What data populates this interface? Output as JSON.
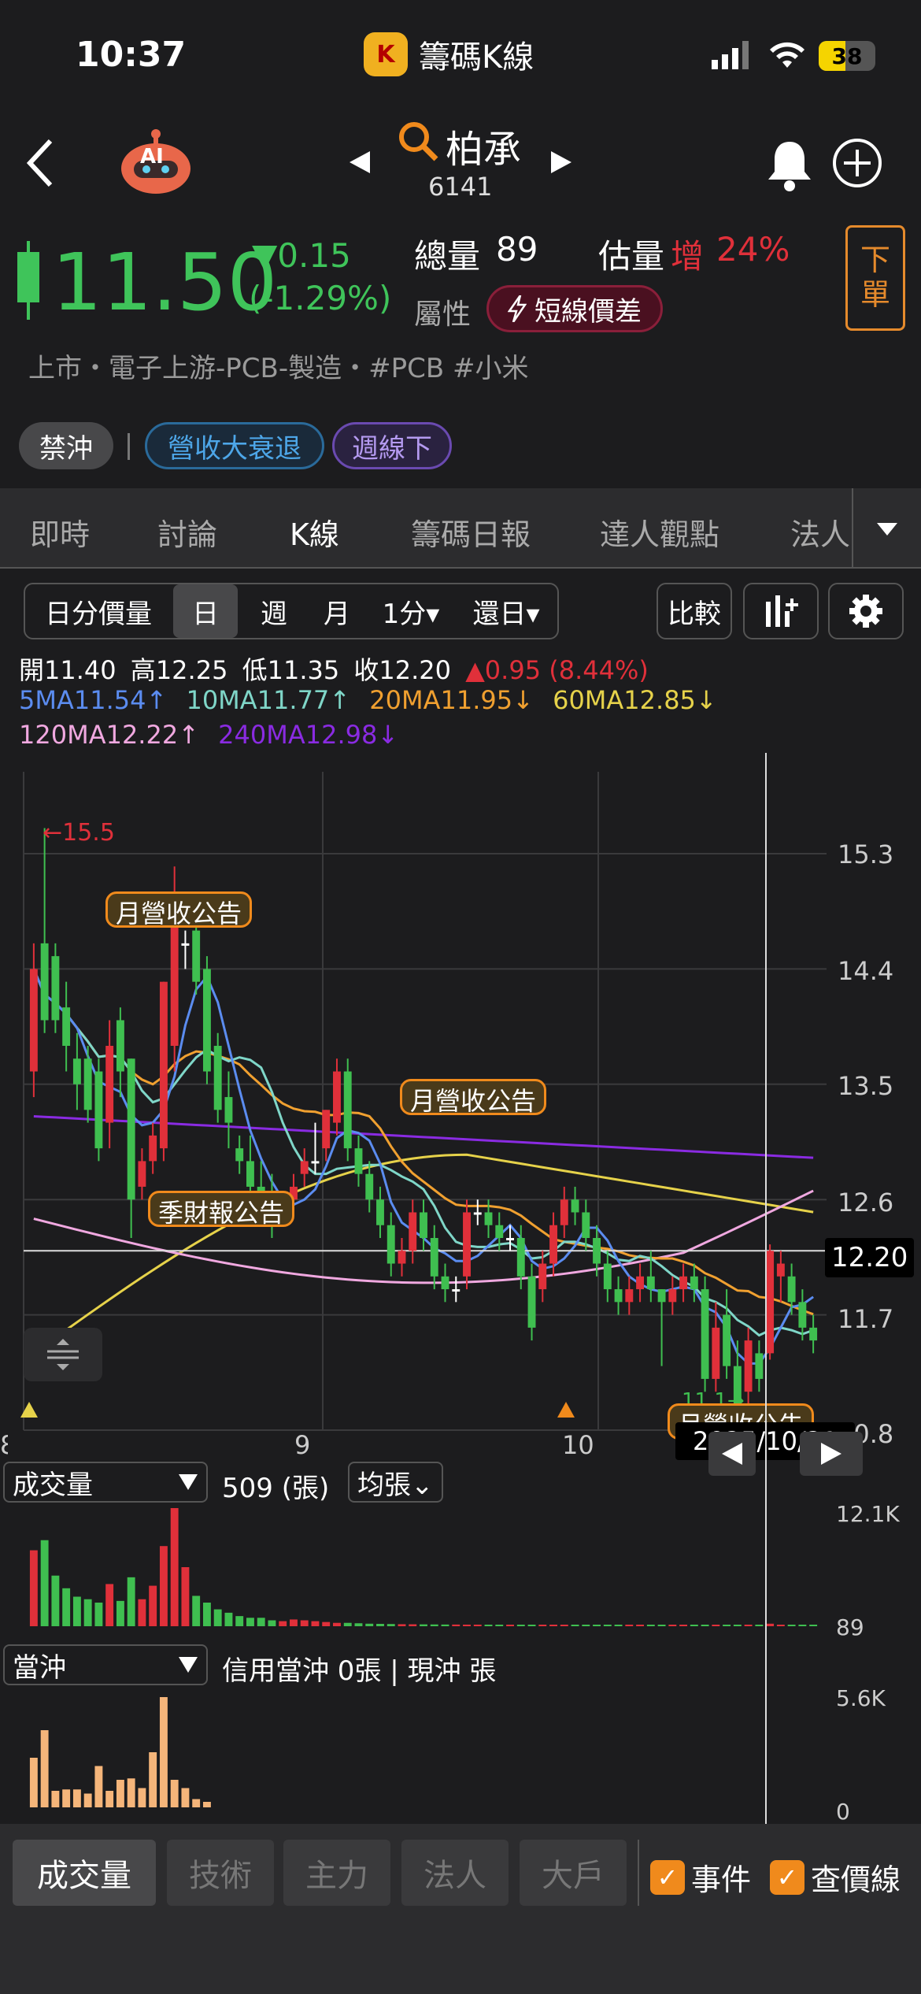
{
  "status": {
    "time": "10:37",
    "app_name": "籌碼K線",
    "app_logo_letter": "K",
    "battery": "38"
  },
  "header": {
    "stock_name": "柏承",
    "stock_code": "6141",
    "price": "11.50",
    "change": "▼0.15",
    "change_pct": "(-1.29%)",
    "volume_label": "總量",
    "volume_value": "89",
    "est_label": "估量",
    "est_dir": "增",
    "est_value": "24%",
    "attr_label": "屬性",
    "attr_badge": "短線價差",
    "order_button": [
      "下",
      "單"
    ],
    "industry": "上市・電子上游-PCB-製造・#PCB #小米",
    "tags": [
      "禁沖",
      "營收大衰退",
      "週線下"
    ],
    "ai_label": "AI"
  },
  "tabs": [
    "即時",
    "討論",
    "K線",
    "籌碼日報",
    "達人觀點",
    "法人"
  ],
  "toolbar": {
    "periods": [
      "日分價量",
      "日",
      "週",
      "月",
      "1分▾",
      "還日▾"
    ],
    "compare": "比較"
  },
  "ohlc": {
    "open_label": "開",
    "open": "11.40",
    "high_label": "高",
    "high": "12.25",
    "low_label": "低",
    "low": "11.35",
    "close_label": "收",
    "close": "12.20",
    "change": "▲0.95 (8.44%)"
  },
  "ma": {
    "ma5": "5MA11.54↑",
    "ma10": "10MA11.77↑",
    "ma20": "20MA11.95↓",
    "ma60": "60MA12.85↓",
    "ma120": "120MA12.22↑",
    "ma240": "240MA12.98↓"
  },
  "colors": {
    "up": "#e0303a",
    "down": "#3fbf50",
    "ma5": "#5b8cf0",
    "ma10": "#7fd6c8",
    "ma20": "#f0a030",
    "ma60": "#e6d24a",
    "ma120": "#f0a8e0",
    "ma240": "#8a2be2",
    "accent": "#f08a1c"
  },
  "chart_data": {
    "type": "candlestick",
    "y_ticks": [
      "15.3",
      "14.4",
      "13.5",
      "12.6",
      "11.7",
      "10.8"
    ],
    "x_ticks": [
      "8",
      "9",
      "10"
    ],
    "max_label": "←15.5",
    "min_label": "11.1→",
    "crosshair_value": "12.20",
    "crosshair_date": "2025/10/21",
    "candles": [
      [
        13.6,
        14.4,
        13.4,
        14.6
      ],
      [
        14.6,
        14.0,
        13.9,
        15.5
      ],
      [
        14.5,
        14.0,
        13.9,
        14.6
      ],
      [
        14.1,
        13.8,
        13.6,
        14.3
      ],
      [
        13.7,
        13.5,
        13.3,
        13.9
      ],
      [
        13.7,
        13.3,
        13.2,
        13.8
      ],
      [
        13.6,
        13.0,
        12.9,
        13.7
      ],
      [
        13.2,
        13.8,
        13.0,
        14.0
      ],
      [
        14.0,
        13.6,
        13.4,
        14.1
      ],
      [
        13.7,
        12.6,
        12.3,
        13.7
      ],
      [
        12.7,
        12.9,
        12.6,
        13.0
      ],
      [
        12.9,
        13.1,
        12.8,
        13.2
      ],
      [
        13.0,
        14.3,
        12.9,
        14.3
      ],
      [
        13.8,
        14.9,
        13.6,
        15.2
      ],
      [
        14.6,
        14.6,
        14.4,
        14.7
      ],
      [
        14.7,
        14.3,
        14.2,
        14.9
      ],
      [
        14.4,
        13.6,
        13.5,
        14.5
      ],
      [
        13.8,
        13.3,
        13.2,
        13.9
      ],
      [
        13.4,
        13.2,
        13.0,
        13.6
      ],
      [
        13.0,
        12.9,
        12.8,
        13.1
      ],
      [
        12.9,
        12.7,
        12.6,
        13.1
      ],
      [
        12.7,
        12.5,
        12.4,
        12.9
      ],
      [
        12.6,
        12.4,
        12.3,
        12.8
      ],
      [
        12.5,
        12.5,
        12.4,
        12.6
      ],
      [
        12.6,
        12.7,
        12.5,
        12.8
      ],
      [
        12.8,
        12.9,
        12.7,
        13.0
      ],
      [
        12.9,
        12.9,
        12.8,
        13.2
      ],
      [
        13.0,
        13.3,
        12.9,
        13.3
      ],
      [
        13.2,
        13.6,
        13.1,
        13.7
      ],
      [
        13.6,
        13.0,
        12.9,
        13.7
      ],
      [
        13.0,
        12.8,
        12.7,
        13.1
      ],
      [
        12.8,
        12.6,
        12.5,
        12.9
      ],
      [
        12.6,
        12.4,
        12.3,
        12.7
      ],
      [
        12.4,
        12.1,
        12.0,
        12.5
      ],
      [
        12.1,
        12.2,
        12.0,
        12.3
      ],
      [
        12.2,
        12.5,
        12.1,
        12.6
      ],
      [
        12.5,
        12.3,
        12.2,
        12.6
      ],
      [
        12.3,
        12.0,
        11.9,
        12.4
      ],
      [
        12.0,
        11.9,
        11.8,
        12.1
      ],
      [
        11.9,
        11.9,
        11.8,
        12.0
      ],
      [
        12.0,
        12.5,
        11.9,
        12.6
      ],
      [
        12.5,
        12.5,
        12.4,
        12.6
      ],
      [
        12.5,
        12.4,
        12.3,
        12.6
      ],
      [
        12.4,
        12.3,
        12.2,
        12.5
      ],
      [
        12.3,
        12.3,
        12.2,
        12.4
      ],
      [
        12.3,
        12.0,
        11.9,
        12.4
      ],
      [
        12.0,
        11.6,
        11.5,
        12.1
      ],
      [
        11.9,
        12.1,
        11.8,
        12.2
      ],
      [
        12.1,
        12.4,
        12.0,
        12.5
      ],
      [
        12.4,
        12.6,
        12.3,
        12.7
      ],
      [
        12.6,
        12.5,
        12.4,
        12.7
      ],
      [
        12.5,
        12.3,
        12.2,
        12.6
      ],
      [
        12.3,
        12.1,
        12.0,
        12.4
      ],
      [
        12.1,
        11.9,
        11.8,
        12.2
      ],
      [
        11.9,
        11.8,
        11.7,
        12.0
      ],
      [
        11.8,
        11.9,
        11.7,
        12.0
      ],
      [
        11.9,
        12.0,
        11.8,
        12.1
      ],
      [
        12.0,
        11.9,
        11.8,
        12.2
      ],
      [
        11.9,
        11.8,
        11.3,
        11.9
      ],
      [
        11.8,
        11.9,
        11.7,
        12.0
      ],
      [
        11.9,
        12.0,
        11.8,
        12.1
      ],
      [
        12.0,
        11.9,
        11.8,
        12.1
      ],
      [
        11.9,
        11.2,
        11.1,
        12.0
      ],
      [
        11.2,
        11.6,
        11.1,
        11.8
      ],
      [
        11.7,
        11.3,
        11.2,
        11.9
      ],
      [
        11.3,
        11.0,
        11.0,
        11.5
      ],
      [
        11.1,
        11.5,
        11.0,
        11.6
      ],
      [
        11.4,
        11.2,
        11.1,
        11.5
      ],
      [
        11.4,
        12.2,
        11.35,
        12.25
      ],
      [
        12.0,
        12.1,
        11.8,
        12.2
      ],
      [
        12.0,
        11.8,
        11.7,
        12.1
      ],
      [
        11.8,
        11.6,
        11.5,
        11.9
      ],
      [
        11.6,
        11.5,
        11.4,
        11.7
      ]
    ],
    "event_labels": [
      "月營收公告",
      "季財報公告",
      "月營收公告",
      "月營收公告"
    ],
    "volume": {
      "label": "成交量",
      "value_text": "509 (張)",
      "avg_button": "均張⌄",
      "max_tick": "12.1K",
      "min_tick": "89",
      "values": [
        9000,
        10200,
        6000,
        4500,
        3500,
        3200,
        2800,
        5000,
        3000,
        5800,
        3200,
        4800,
        9500,
        14000,
        7000,
        3600,
        2800,
        2000,
        1600,
        1200,
        1000,
        1000,
        700,
        600,
        800,
        700,
        600,
        500,
        400,
        400,
        350,
        300,
        280,
        260,
        240,
        230,
        220,
        210,
        200,
        200,
        190,
        190,
        180,
        180,
        170,
        170,
        160,
        160,
        150,
        150,
        140,
        140,
        130,
        130,
        130,
        120,
        120,
        120,
        110,
        110,
        110,
        100,
        100,
        100,
        100,
        95,
        95,
        95,
        300,
        150,
        110,
        100,
        89
      ]
    },
    "daytrade": {
      "label": "當沖",
      "value_text": "信用當沖 0張 | 現沖 張",
      "max_tick": "5.6K",
      "min_tick": "0",
      "values": [
        3600,
        5600,
        1200,
        1300,
        1300,
        1000,
        3000,
        1200,
        2000,
        2100,
        1400,
        4000,
        8000,
        2000,
        1400,
        600,
        400
      ]
    }
  },
  "bottom": {
    "buttons": [
      "成交量",
      "技術",
      "主力",
      "法人",
      "大戶"
    ],
    "checks": [
      "事件",
      "查價線"
    ]
  }
}
